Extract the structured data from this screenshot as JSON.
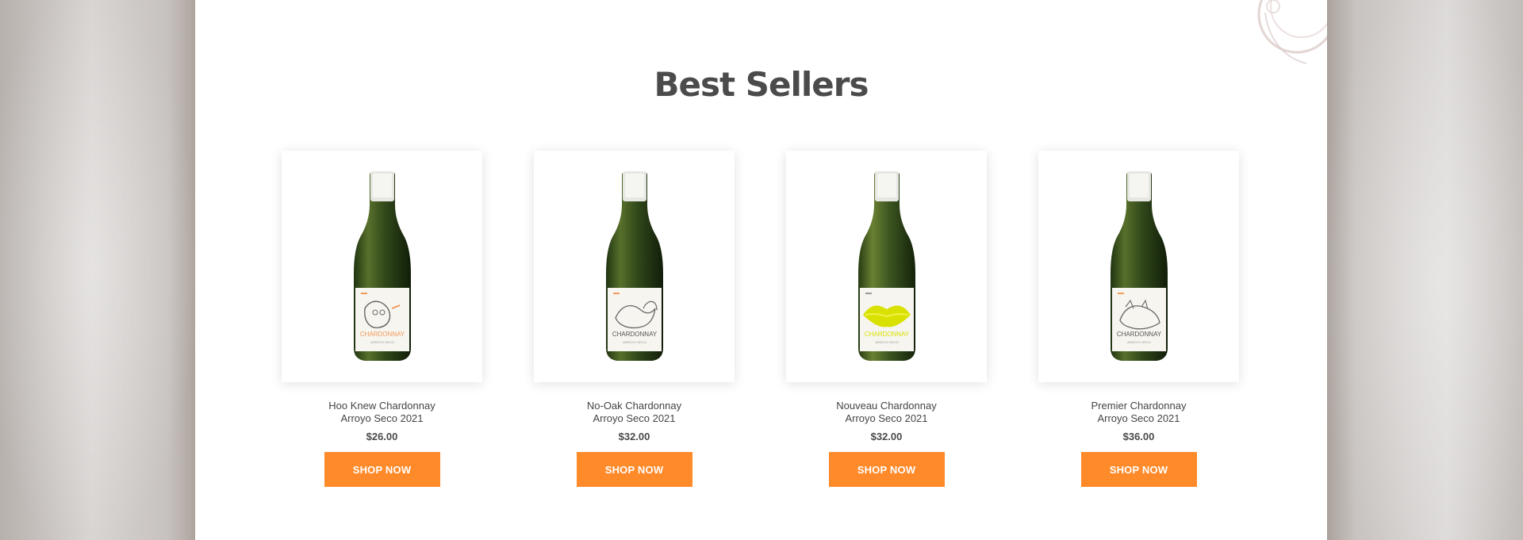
{
  "section": {
    "title": "Best Sellers"
  },
  "products": [
    {
      "name_line1": "Hoo Knew Chardonnay",
      "name_line2": "Arroyo Seco 2021",
      "price": "$26.00",
      "button_label": "SHOP NOW",
      "label_art": "owl",
      "label_text": "CHARDONNAY",
      "accent_color": "#f19a5b"
    },
    {
      "name_line1": "No-Oak Chardonnay",
      "name_line2": "Arroyo Seco 2021",
      "price": "$32.00",
      "button_label": "SHOP NOW",
      "label_art": "squirrel",
      "label_text": "CHARDONNAY",
      "accent_color": "#f19a5b"
    },
    {
      "name_line1": "Nouveau Chardonnay",
      "name_line2": "Arroyo Seco 2021",
      "price": "$32.00",
      "button_label": "SHOP NOW",
      "label_art": "lips",
      "label_text": "CHARDONNAY",
      "accent_color": "#d8e100"
    },
    {
      "name_line1": "Premier Chardonnay",
      "name_line2": "Arroyo Seco 2021",
      "price": "$36.00",
      "button_label": "SHOP NOW",
      "label_art": "cat",
      "label_text": "CHARDONNAY",
      "accent_color": "#f19a5b"
    }
  ],
  "colors": {
    "button": "#ff8a2a",
    "title": "#4b4b4b",
    "panel": "#ffffff"
  }
}
